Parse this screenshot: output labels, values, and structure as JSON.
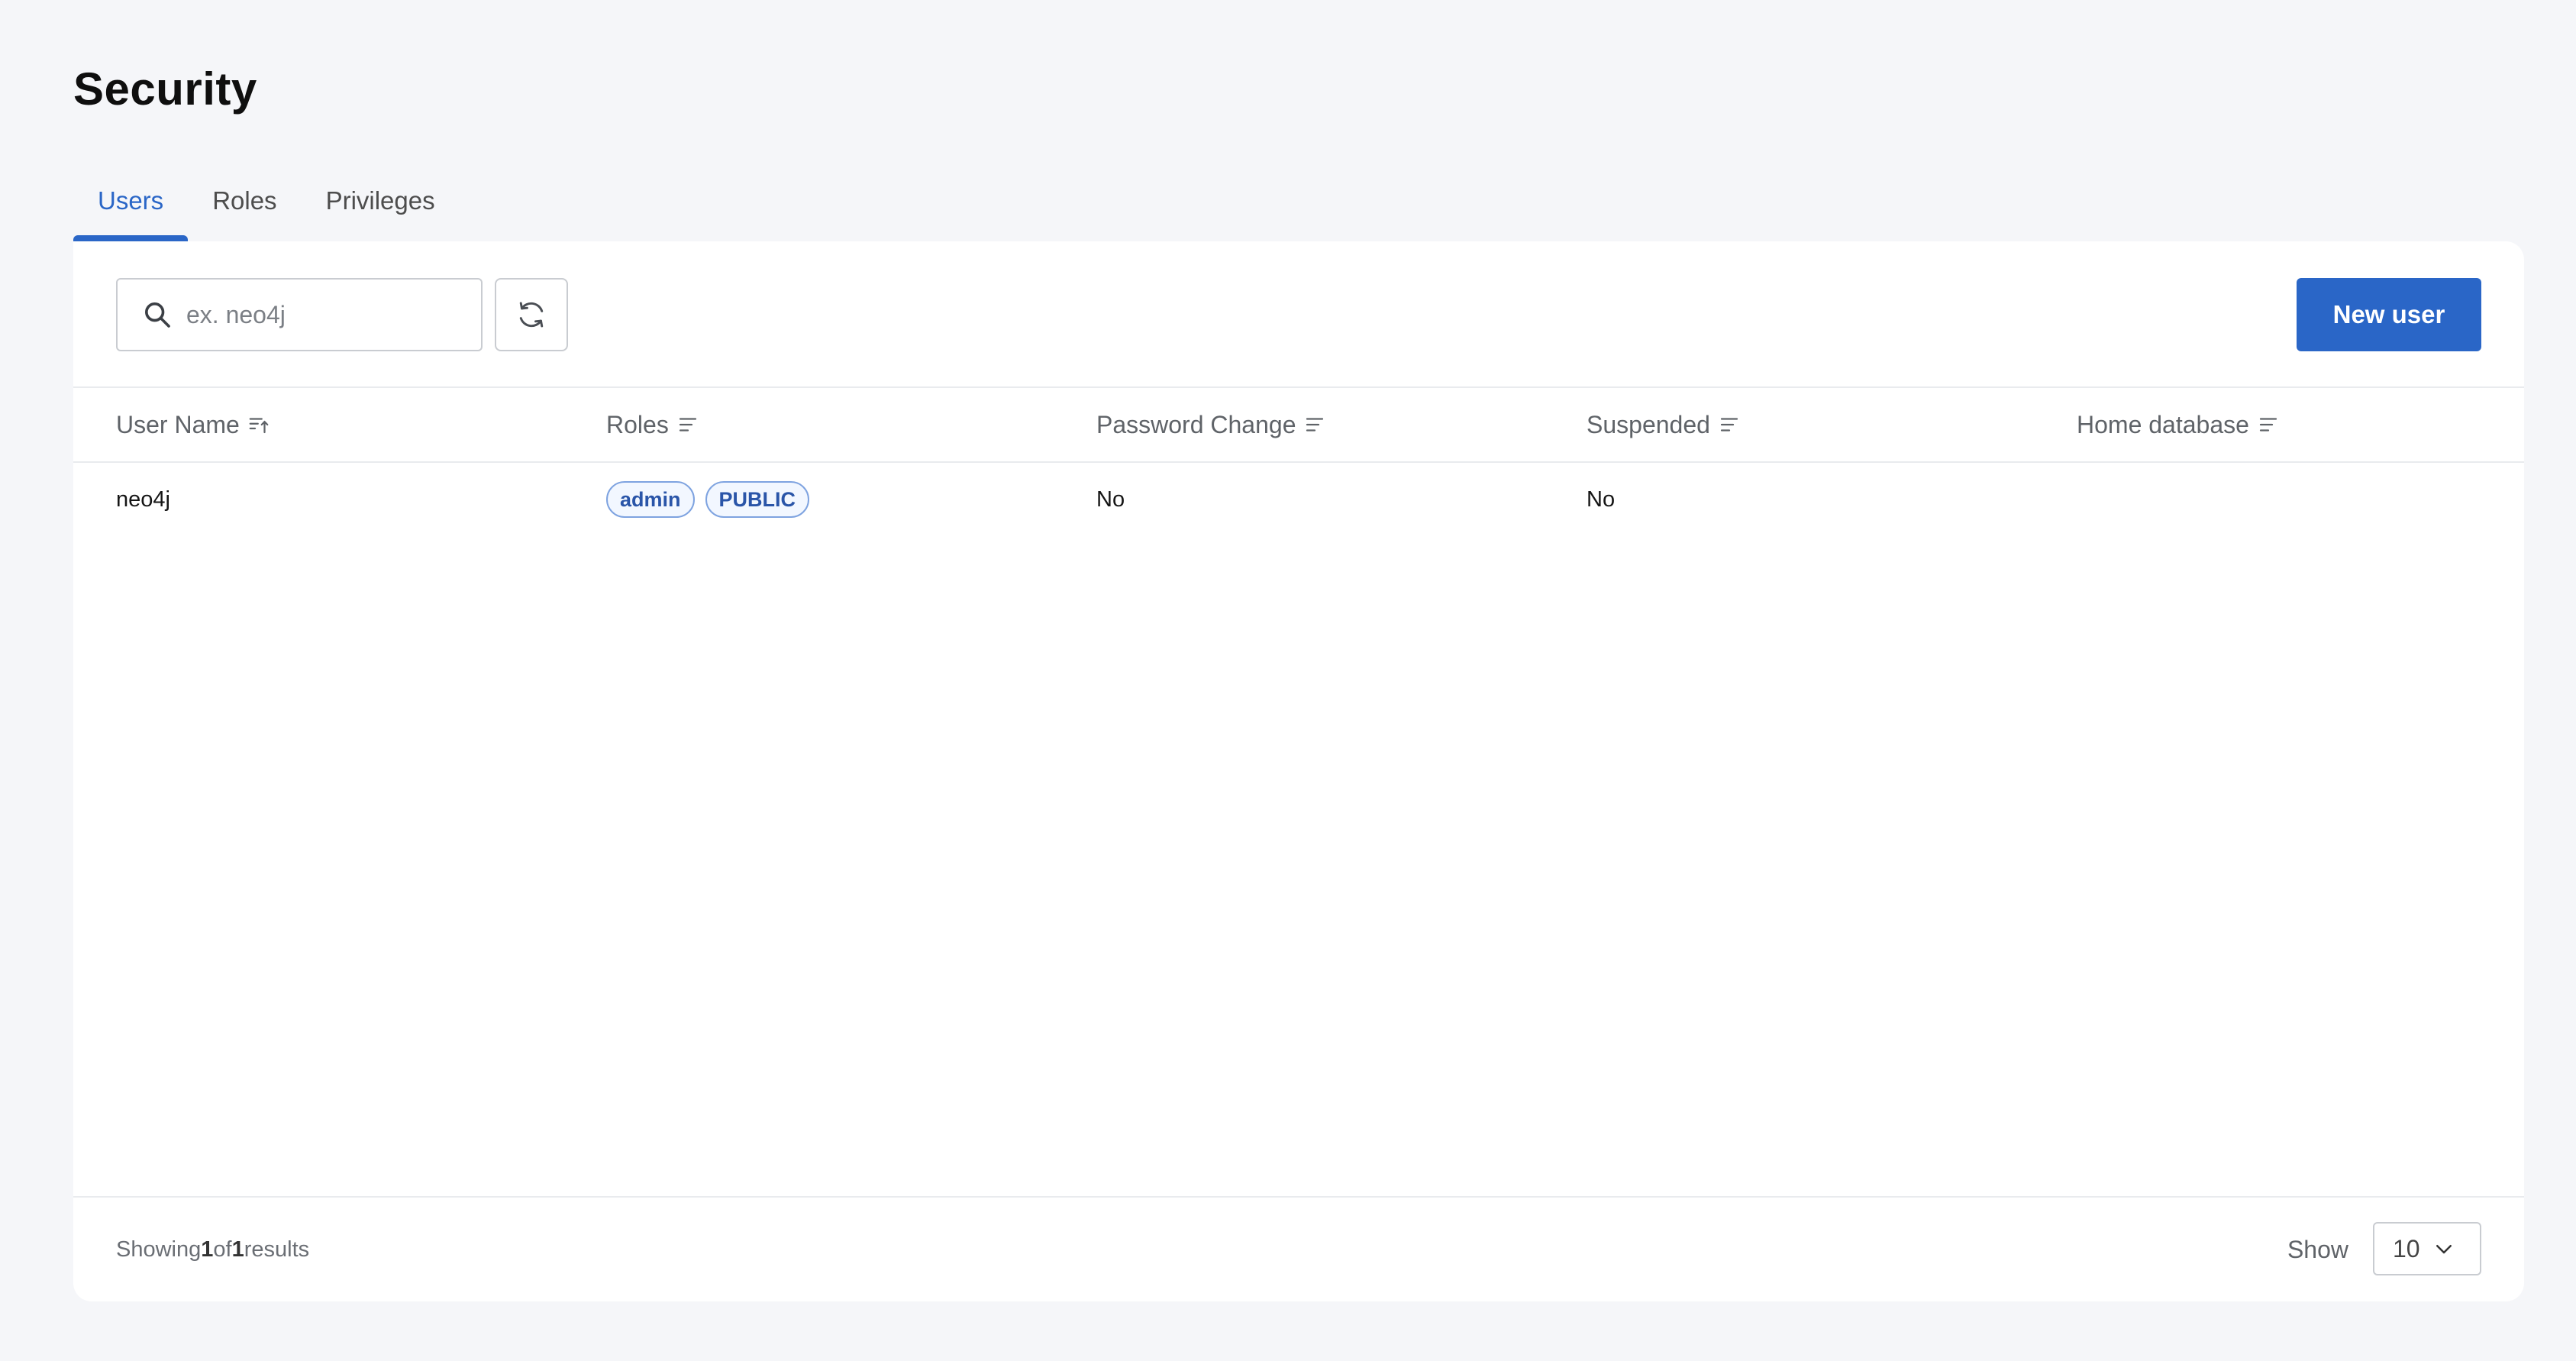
{
  "page": {
    "title": "Security"
  },
  "tabs": [
    {
      "label": "Users",
      "active": true
    },
    {
      "label": "Roles",
      "active": false
    },
    {
      "label": "Privileges",
      "active": false
    }
  ],
  "toolbar": {
    "search_placeholder": "ex. neo4j",
    "search_value": "",
    "refresh_icon": "refresh-icon",
    "new_user_label": "New user"
  },
  "table": {
    "columns": [
      {
        "label": "User Name",
        "icon": "sort-ascending-icon"
      },
      {
        "label": "Roles",
        "icon": "sort-icon"
      },
      {
        "label": "Password Change",
        "icon": "sort-icon"
      },
      {
        "label": "Suspended",
        "icon": "sort-icon"
      },
      {
        "label": "Home database",
        "icon": "sort-icon"
      }
    ],
    "rows": [
      {
        "user_name": "neo4j",
        "roles": [
          "admin",
          "PUBLIC"
        ],
        "password_change": "No",
        "suspended": "No",
        "home_database": ""
      }
    ]
  },
  "footer": {
    "showing_prefix": "Showing",
    "showing_count": "1",
    "showing_of": "of",
    "showing_total": "1",
    "showing_suffix": "results",
    "show_label": "Show",
    "page_size": "10"
  },
  "colors": {
    "accent": "#2a66c7",
    "background": "#f5f6f9",
    "card": "#ffffff",
    "chip_border": "#7ea3e0",
    "chip_text": "#2a55a8"
  }
}
